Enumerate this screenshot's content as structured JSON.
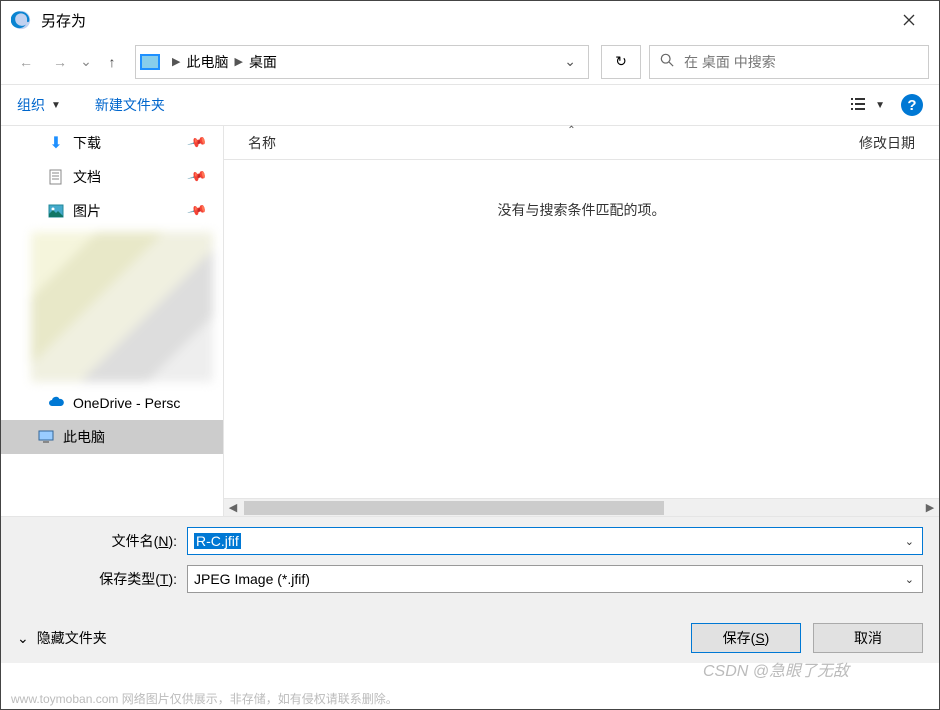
{
  "title": "另存为",
  "breadcrumb": {
    "root": "此电脑",
    "current": "桌面"
  },
  "refresh_icon": "↻",
  "search": {
    "placeholder": "在 桌面 中搜索"
  },
  "toolbar": {
    "organize": "组织",
    "new_folder": "新建文件夹"
  },
  "sidebar": {
    "downloads": "下载",
    "documents": "文档",
    "pictures": "图片",
    "onedrive": "OneDrive - Persc",
    "this_pc": "此电脑"
  },
  "columns": {
    "name": "名称",
    "date_modified": "修改日期"
  },
  "empty_message": "没有与搜索条件匹配的项。",
  "filename_label_pre": "文件名(",
  "filename_label_key": "N",
  "filename_label_post": "):",
  "filetype_label_pre": "保存类型(",
  "filetype_label_key": "T",
  "filetype_label_post": "):",
  "filename_value": "R-C.jfif",
  "filetype_value": "JPEG Image (*.jfif)",
  "hide_folders": "隐藏文件夹",
  "save_btn_pre": "保存(",
  "save_btn_key": "S",
  "save_btn_post": ")",
  "cancel_btn": "取消",
  "watermark": "CSDN @急眼了无敌",
  "footer_note": "www.toymoban.com  网络图片仅供展示，非存储，如有侵权请联系删除。"
}
